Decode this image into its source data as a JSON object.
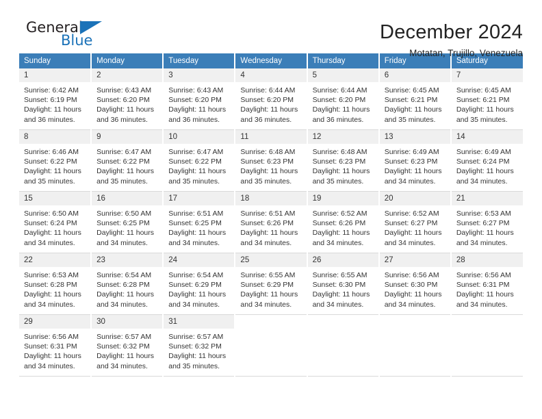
{
  "brand": {
    "name_top": "General",
    "name_bottom": "Blue",
    "triangle_color": "#1b72b8"
  },
  "header": {
    "title": "December 2024",
    "subtitle": "Motatan, Trujillo, Venezuela"
  },
  "theme": {
    "header_blue": "#3b7eb8",
    "daynum_bg": "#f0f0f0",
    "text": "#333333"
  },
  "calendar": {
    "day_headers": [
      "Sunday",
      "Monday",
      "Tuesday",
      "Wednesday",
      "Thursday",
      "Friday",
      "Saturday"
    ],
    "weeks": [
      [
        {
          "day": "1",
          "sunrise": "Sunrise: 6:42 AM",
          "sunset": "Sunset: 6:19 PM",
          "daylight": "Daylight: 11 hours and 36 minutes."
        },
        {
          "day": "2",
          "sunrise": "Sunrise: 6:43 AM",
          "sunset": "Sunset: 6:20 PM",
          "daylight": "Daylight: 11 hours and 36 minutes."
        },
        {
          "day": "3",
          "sunrise": "Sunrise: 6:43 AM",
          "sunset": "Sunset: 6:20 PM",
          "daylight": "Daylight: 11 hours and 36 minutes."
        },
        {
          "day": "4",
          "sunrise": "Sunrise: 6:44 AM",
          "sunset": "Sunset: 6:20 PM",
          "daylight": "Daylight: 11 hours and 36 minutes."
        },
        {
          "day": "5",
          "sunrise": "Sunrise: 6:44 AM",
          "sunset": "Sunset: 6:20 PM",
          "daylight": "Daylight: 11 hours and 36 minutes."
        },
        {
          "day": "6",
          "sunrise": "Sunrise: 6:45 AM",
          "sunset": "Sunset: 6:21 PM",
          "daylight": "Daylight: 11 hours and 35 minutes."
        },
        {
          "day": "7",
          "sunrise": "Sunrise: 6:45 AM",
          "sunset": "Sunset: 6:21 PM",
          "daylight": "Daylight: 11 hours and 35 minutes."
        }
      ],
      [
        {
          "day": "8",
          "sunrise": "Sunrise: 6:46 AM",
          "sunset": "Sunset: 6:22 PM",
          "daylight": "Daylight: 11 hours and 35 minutes."
        },
        {
          "day": "9",
          "sunrise": "Sunrise: 6:47 AM",
          "sunset": "Sunset: 6:22 PM",
          "daylight": "Daylight: 11 hours and 35 minutes."
        },
        {
          "day": "10",
          "sunrise": "Sunrise: 6:47 AM",
          "sunset": "Sunset: 6:22 PM",
          "daylight": "Daylight: 11 hours and 35 minutes."
        },
        {
          "day": "11",
          "sunrise": "Sunrise: 6:48 AM",
          "sunset": "Sunset: 6:23 PM",
          "daylight": "Daylight: 11 hours and 35 minutes."
        },
        {
          "day": "12",
          "sunrise": "Sunrise: 6:48 AM",
          "sunset": "Sunset: 6:23 PM",
          "daylight": "Daylight: 11 hours and 35 minutes."
        },
        {
          "day": "13",
          "sunrise": "Sunrise: 6:49 AM",
          "sunset": "Sunset: 6:23 PM",
          "daylight": "Daylight: 11 hours and 34 minutes."
        },
        {
          "day": "14",
          "sunrise": "Sunrise: 6:49 AM",
          "sunset": "Sunset: 6:24 PM",
          "daylight": "Daylight: 11 hours and 34 minutes."
        }
      ],
      [
        {
          "day": "15",
          "sunrise": "Sunrise: 6:50 AM",
          "sunset": "Sunset: 6:24 PM",
          "daylight": "Daylight: 11 hours and 34 minutes."
        },
        {
          "day": "16",
          "sunrise": "Sunrise: 6:50 AM",
          "sunset": "Sunset: 6:25 PM",
          "daylight": "Daylight: 11 hours and 34 minutes."
        },
        {
          "day": "17",
          "sunrise": "Sunrise: 6:51 AM",
          "sunset": "Sunset: 6:25 PM",
          "daylight": "Daylight: 11 hours and 34 minutes."
        },
        {
          "day": "18",
          "sunrise": "Sunrise: 6:51 AM",
          "sunset": "Sunset: 6:26 PM",
          "daylight": "Daylight: 11 hours and 34 minutes."
        },
        {
          "day": "19",
          "sunrise": "Sunrise: 6:52 AM",
          "sunset": "Sunset: 6:26 PM",
          "daylight": "Daylight: 11 hours and 34 minutes."
        },
        {
          "day": "20",
          "sunrise": "Sunrise: 6:52 AM",
          "sunset": "Sunset: 6:27 PM",
          "daylight": "Daylight: 11 hours and 34 minutes."
        },
        {
          "day": "21",
          "sunrise": "Sunrise: 6:53 AM",
          "sunset": "Sunset: 6:27 PM",
          "daylight": "Daylight: 11 hours and 34 minutes."
        }
      ],
      [
        {
          "day": "22",
          "sunrise": "Sunrise: 6:53 AM",
          "sunset": "Sunset: 6:28 PM",
          "daylight": "Daylight: 11 hours and 34 minutes."
        },
        {
          "day": "23",
          "sunrise": "Sunrise: 6:54 AM",
          "sunset": "Sunset: 6:28 PM",
          "daylight": "Daylight: 11 hours and 34 minutes."
        },
        {
          "day": "24",
          "sunrise": "Sunrise: 6:54 AM",
          "sunset": "Sunset: 6:29 PM",
          "daylight": "Daylight: 11 hours and 34 minutes."
        },
        {
          "day": "25",
          "sunrise": "Sunrise: 6:55 AM",
          "sunset": "Sunset: 6:29 PM",
          "daylight": "Daylight: 11 hours and 34 minutes."
        },
        {
          "day": "26",
          "sunrise": "Sunrise: 6:55 AM",
          "sunset": "Sunset: 6:30 PM",
          "daylight": "Daylight: 11 hours and 34 minutes."
        },
        {
          "day": "27",
          "sunrise": "Sunrise: 6:56 AM",
          "sunset": "Sunset: 6:30 PM",
          "daylight": "Daylight: 11 hours and 34 minutes."
        },
        {
          "day": "28",
          "sunrise": "Sunrise: 6:56 AM",
          "sunset": "Sunset: 6:31 PM",
          "daylight": "Daylight: 11 hours and 34 minutes."
        }
      ],
      [
        {
          "day": "29",
          "sunrise": "Sunrise: 6:56 AM",
          "sunset": "Sunset: 6:31 PM",
          "daylight": "Daylight: 11 hours and 34 minutes."
        },
        {
          "day": "30",
          "sunrise": "Sunrise: 6:57 AM",
          "sunset": "Sunset: 6:32 PM",
          "daylight": "Daylight: 11 hours and 34 minutes."
        },
        {
          "day": "31",
          "sunrise": "Sunrise: 6:57 AM",
          "sunset": "Sunset: 6:32 PM",
          "daylight": "Daylight: 11 hours and 35 minutes."
        },
        null,
        null,
        null,
        null
      ]
    ]
  }
}
